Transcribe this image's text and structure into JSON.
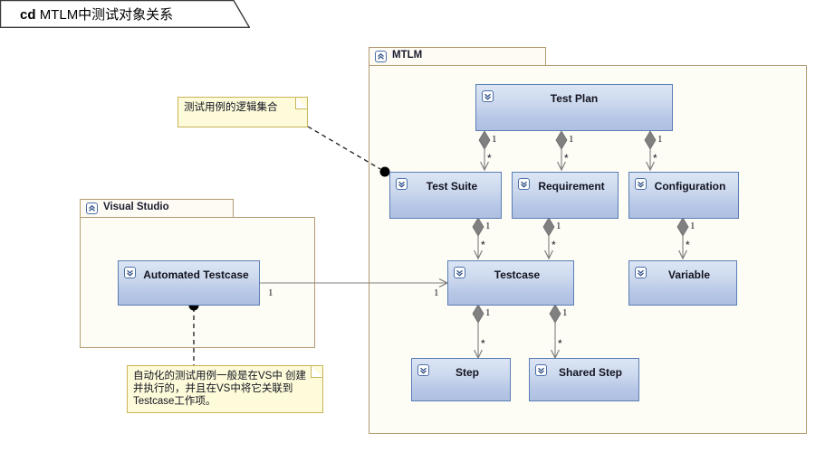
{
  "diagram": {
    "title_prefix": "cd",
    "title": "MTLM中测试对象关系"
  },
  "packages": [
    {
      "id": "mtlm",
      "name": "MTLM",
      "icon": "package-icon"
    },
    {
      "id": "vs",
      "name": "Visual Studio",
      "icon": "package-icon"
    }
  ],
  "classes": [
    {
      "id": "test_plan",
      "name": "Test  Plan",
      "icon": "class-expand-icon"
    },
    {
      "id": "test_suite",
      "name": "Test Suite",
      "icon": "class-expand-icon"
    },
    {
      "id": "requirement",
      "name": "Requirement",
      "icon": "class-expand-icon"
    },
    {
      "id": "configuration",
      "name": "Configuration",
      "icon": "class-expand-icon"
    },
    {
      "id": "testcase",
      "name": "Testcase",
      "icon": "class-expand-icon"
    },
    {
      "id": "variable",
      "name": "Variable",
      "icon": "class-expand-icon"
    },
    {
      "id": "step",
      "name": "Step",
      "icon": "class-expand-icon"
    },
    {
      "id": "shared_step",
      "name": "Shared Step",
      "icon": "class-expand-icon"
    },
    {
      "id": "automated_testcase",
      "name": "Automated Testcase",
      "icon": "class-expand-icon"
    }
  ],
  "notes": [
    {
      "id": "note_suite",
      "text": "测试用例的逻辑集合"
    },
    {
      "id": "note_auto",
      "text": "自动化的测试用例一般是在VS中 创建\n并执行的，并且在VS中将它关联到\nTestcase工作项。"
    }
  ],
  "relations": [
    {
      "id": "plan_suite",
      "from": "test_plan",
      "to": "test_suite",
      "type": "composition",
      "source_mult": "1",
      "target_mult": "*"
    },
    {
      "id": "plan_req",
      "from": "test_plan",
      "to": "requirement",
      "type": "composition",
      "source_mult": "1",
      "target_mult": "*"
    },
    {
      "id": "plan_config",
      "from": "test_plan",
      "to": "configuration",
      "type": "composition",
      "source_mult": "1",
      "target_mult": "*"
    },
    {
      "id": "suite_case",
      "from": "test_suite",
      "to": "testcase",
      "type": "composition",
      "source_mult": "1",
      "target_mult": "*"
    },
    {
      "id": "req_case",
      "from": "requirement",
      "to": "testcase",
      "type": "composition",
      "source_mult": "1",
      "target_mult": "*"
    },
    {
      "id": "config_var",
      "from": "configuration",
      "to": "variable",
      "type": "composition",
      "source_mult": "1",
      "target_mult": "*"
    },
    {
      "id": "case_step",
      "from": "testcase",
      "to": "step",
      "type": "composition",
      "source_mult": "1",
      "target_mult": "*"
    },
    {
      "id": "case_shared",
      "from": "testcase",
      "to": "shared_step",
      "type": "composition",
      "source_mult": "1",
      "target_mult": "*"
    },
    {
      "id": "auto_case",
      "from": "automated_testcase",
      "to": "testcase",
      "type": "association",
      "source_mult": "1",
      "target_mult": "1"
    }
  ],
  "multiplicity_labels": {
    "one": "1",
    "many": "*"
  },
  "colors": {
    "class_border": "#5a7fb5",
    "class_fill_top": "#dbe5f4",
    "class_fill_bottom": "#aebfe1",
    "package_border": "#b49b72",
    "package_fill": "#fdfcf5",
    "note_border": "#c9b458",
    "note_fill": "#fdfbd9",
    "connector": "#7f7f7f",
    "diamond": "#808080",
    "anchor_dot": "#000000",
    "canvas": "#ffffff"
  }
}
